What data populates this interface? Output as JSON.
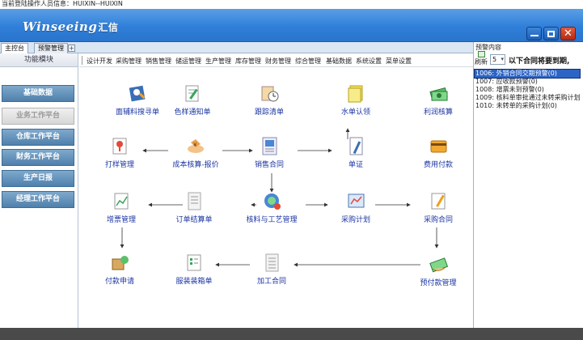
{
  "login_info": "当前登陆操作人员信息：HUIXIN--HUIXIN",
  "app": {
    "logo": "Winseeing",
    "logo_cn": "汇信"
  },
  "tabs": [
    {
      "label": "主控台"
    },
    {
      "label": "预警管理"
    }
  ],
  "tab_add": "+",
  "left_panel": {
    "header": "功能模块",
    "items": [
      {
        "label": "基础数据"
      },
      {
        "label": "业务工作平台"
      },
      {
        "label": "仓库工作平台"
      },
      {
        "label": "财务工作平台"
      },
      {
        "label": "生产日报"
      },
      {
        "label": "经理工作平台"
      }
    ]
  },
  "menu": [
    "设计开发",
    "采购管理",
    "销售管理",
    "储运管理",
    "生产管理",
    "库存管理",
    "财务管理",
    "综合管理",
    "基础数据",
    "系统设置",
    "菜单设置"
  ],
  "flow": {
    "mianfuliao": "面辅料搜寻单",
    "seyang": "色样通知单",
    "gendan": "跟踪清单",
    "shuidan": "水单认领",
    "lirun": "利润核算",
    "dayang": "打样管理",
    "chengben": "成本核算-报价",
    "xiaoshou": "销售合同",
    "danzheng": "单证",
    "feiyong": "费用付款",
    "zengpiao": "增票管理",
    "dingdanjiesuan": "订单结算单",
    "heliao": "核料与工艺管理",
    "caigoujihua": "采购计划",
    "caigouhetong": "采购合同",
    "fukuan": "付款申请",
    "zhuangxiang": "服装装箱单",
    "jiagong": "加工合同",
    "yufukuan": "预付款管理"
  },
  "alert_panel": {
    "title": "预警内容",
    "refresh_label": "刷新",
    "count": "5",
    "notice": "以下合同将要到期,",
    "items": [
      "1006: 外销合同交期预警(0)",
      "1007: 应收款预警(0)",
      "1008: 增票未到预警(0)",
      "1009: 核料单审批通过未转采购计划",
      "1010: 未转单的采购计划(0)"
    ]
  }
}
